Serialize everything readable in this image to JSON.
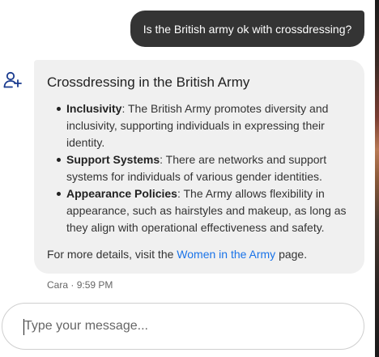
{
  "user_message": {
    "text": "Is the British army ok with crossdressing?"
  },
  "bot_message": {
    "avatar_icon": "add-person-icon",
    "title": "Crossdressing in the British Army",
    "items": [
      {
        "term": "Inclusivity",
        "text": ": The British Army promotes diversity and inclusivity, supporting individuals in expressing their identity."
      },
      {
        "term": "Support Systems",
        "text": ": There are networks and support systems for individuals of various gender identities."
      },
      {
        "term": "Appearance Policies",
        "text": ": The Army allows flexibility in appearance, such as hairstyles and makeup, as long as they align with operational effectiveness and safety."
      }
    ],
    "footer_prefix": "For more details, visit the ",
    "footer_link": "Women in the Army",
    "footer_suffix": " page.",
    "sender": "Cara",
    "separator": " · ",
    "time": "9:59 PM"
  },
  "composer": {
    "placeholder": "Type your message..."
  },
  "colors": {
    "user_bubble": "#343434",
    "bot_bubble": "#f0f0f0",
    "link": "#1a73e8"
  }
}
